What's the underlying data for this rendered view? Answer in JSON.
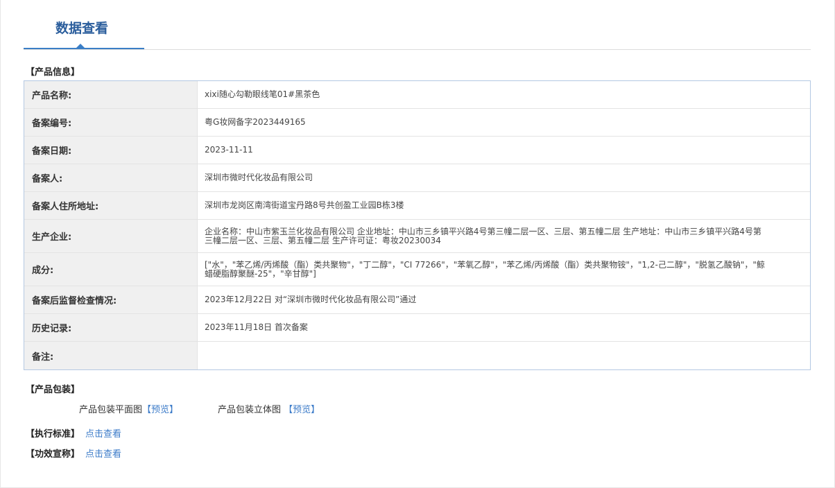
{
  "header": {
    "tab_title": "数据查看"
  },
  "sections": {
    "product_info": "【产品信息】",
    "product_packaging": "【产品包装】",
    "execution_standard": "【执行标准】",
    "efficacy_claim": "【功效宣称】"
  },
  "table": {
    "rows": [
      {
        "label": "产品名称:",
        "value": "xixi随心勾勒眼线笔01#黑茶色"
      },
      {
        "label": "备案编号:",
        "value": "粤G妆网备字2023449165"
      },
      {
        "label": "备案日期:",
        "value": "2023-11-11"
      },
      {
        "label": "备案人:",
        "value": "深圳市微时代化妆品有限公司"
      },
      {
        "label": "备案人住所地址:",
        "value": "深圳市龙岗区南湾街道宝丹路8号共创盈工业园B栋3楼"
      },
      {
        "label": "生产企业:",
        "value": "企业名称：中山市紫玉兰化妆品有限公司 企业地址：中山市三乡镇平兴路4号第三幢二层一区、三层、第五幢二层 生产地址：中山市三乡镇平兴路4号第三幢二层一区、三层、第五幢二层 生产许可证：粤妆20230034"
      },
      {
        "label": "成分:",
        "value": "[\"水\"，\"苯乙烯/丙烯酸（酯）类共聚物\"，\"丁二醇\"，\"CI 77266\"，\"苯氧乙醇\"，\"苯乙烯/丙烯酸（酯）类共聚物铵\"，\"1,2-己二醇\"，\"脱氢乙酸钠\"，\"鲸蜡硬脂醇聚醚-25\"，\"辛甘醇\"]"
      },
      {
        "label": "备案后监督检查情况:",
        "value": "2023年12月22日 对“深圳市微时代化妆品有限公司”通过"
      },
      {
        "label": "历史记录:",
        "value": "2023年11月18日 首次备案"
      },
      {
        "label": "备注:",
        "value": ""
      }
    ]
  },
  "packaging": {
    "flat_label": "产品包装平面图",
    "flat_link": "【预览】",
    "solid_label": "产品包装立体图",
    "solid_link": "【预览】"
  },
  "links": {
    "execution_standard_link": "点击查看",
    "efficacy_claim_link": "点击查看"
  },
  "colors": {
    "accent": "#3a7ec6",
    "title": "#2a5d9c",
    "link": "#3d7cc9",
    "table_border": "#b3c8e2",
    "label_bg": "#f0f0f0"
  }
}
